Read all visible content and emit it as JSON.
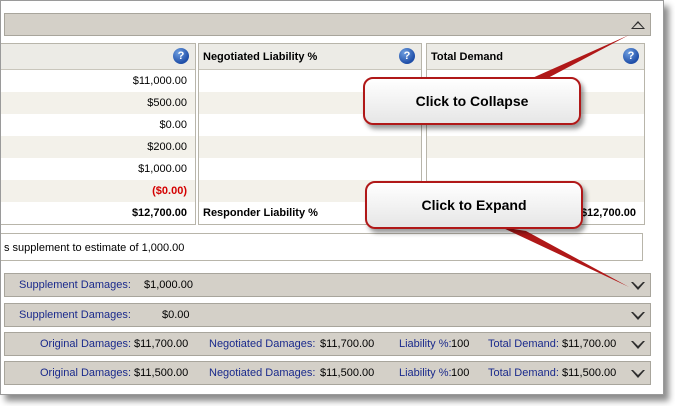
{
  "columns": [
    {
      "title": "",
      "rows": [
        "$11,000.00",
        "$500.00",
        "$0.00",
        "$200.00",
        "$1,000.00",
        "($0.00)"
      ],
      "total": "$12,700.00"
    },
    {
      "title": "Negotiated Liability %",
      "total_label": "Responder Liability %"
    },
    {
      "title": "Total Demand",
      "total": "$12,700.00"
    }
  ],
  "help_icon": "question-mark-icon",
  "note": "s supplement to estimate of 1,000.00",
  "callouts": {
    "collapse": "Click to Collapse",
    "expand": "Click to Expand"
  },
  "supplements": [
    {
      "label": "Supplement Damages:",
      "value": "$1,000.00"
    },
    {
      "label": "Supplement Damages:",
      "value": "$0.00"
    }
  ],
  "summaries": [
    {
      "original_label": "Original Damages:",
      "original_value": "$11,700.00",
      "negotiated_label": "Negotiated Damages:",
      "negotiated_value": "$11,700.00",
      "liability_label": "Liability %:",
      "liability_value": "100",
      "demand_label": "Total Demand:",
      "demand_value": "$11,700.00"
    },
    {
      "original_label": "Original Damages:",
      "original_value": "$11,500.00",
      "negotiated_label": "Negotiated Damages:",
      "negotiated_value": "$11,500.00",
      "liability_label": "Liability %:",
      "liability_value": "100",
      "demand_label": "Total Demand:",
      "demand_value": "$11,500.00"
    }
  ],
  "colors": {
    "bar": "#d4d0c8",
    "label_blue": "#1a2a8c",
    "negative": "#d40000",
    "callout_border": "#b01818"
  }
}
